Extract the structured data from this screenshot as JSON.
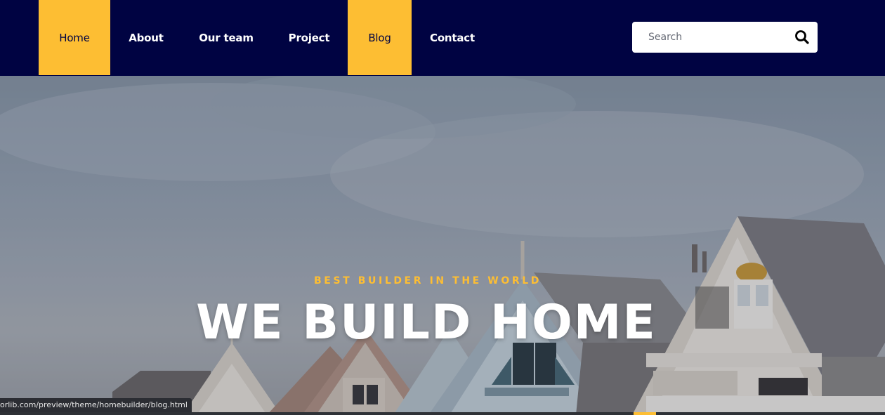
{
  "nav": {
    "items": [
      {
        "label": "Home"
      },
      {
        "label": "About"
      },
      {
        "label": "Our team"
      },
      {
        "label": "Project"
      },
      {
        "label": "Blog"
      },
      {
        "label": "Contact"
      }
    ]
  },
  "search": {
    "placeholder": "Search",
    "value": ""
  },
  "hero": {
    "subtitle": "BEST BUILDER IN THE WORLD",
    "title": "WE BUILD HOME"
  },
  "status_bar": {
    "url": "orlib.com/preview/theme/homebuilder/blog.html"
  },
  "colors": {
    "nav_bg": "#000342",
    "accent": "#fdbe33",
    "text_light": "#ffffff"
  },
  "icons": {
    "search": "search-icon"
  }
}
